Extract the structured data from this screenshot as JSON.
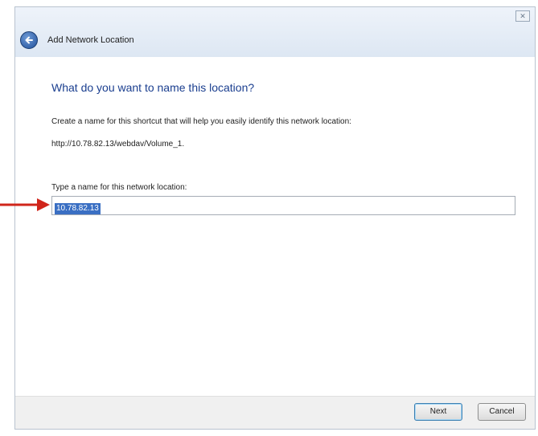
{
  "window": {
    "title": "Add Network Location",
    "close_glyph": "✕"
  },
  "content": {
    "heading": "What do you want to name this location?",
    "description": "Create a name for this shortcut that will help you easily identify this network location:",
    "url": "http://10.78.82.13/webdav/Volume_1.",
    "name_label": "Type a name for this network location:",
    "name_value": "10.78.82.13"
  },
  "buttons": {
    "next": "Next",
    "cancel": "Cancel"
  },
  "annotation": {
    "arrow_color": "#d0251b"
  },
  "icons": {
    "back": "back-arrow-icon",
    "close": "close-icon",
    "annotation": "red-arrow-icon"
  }
}
